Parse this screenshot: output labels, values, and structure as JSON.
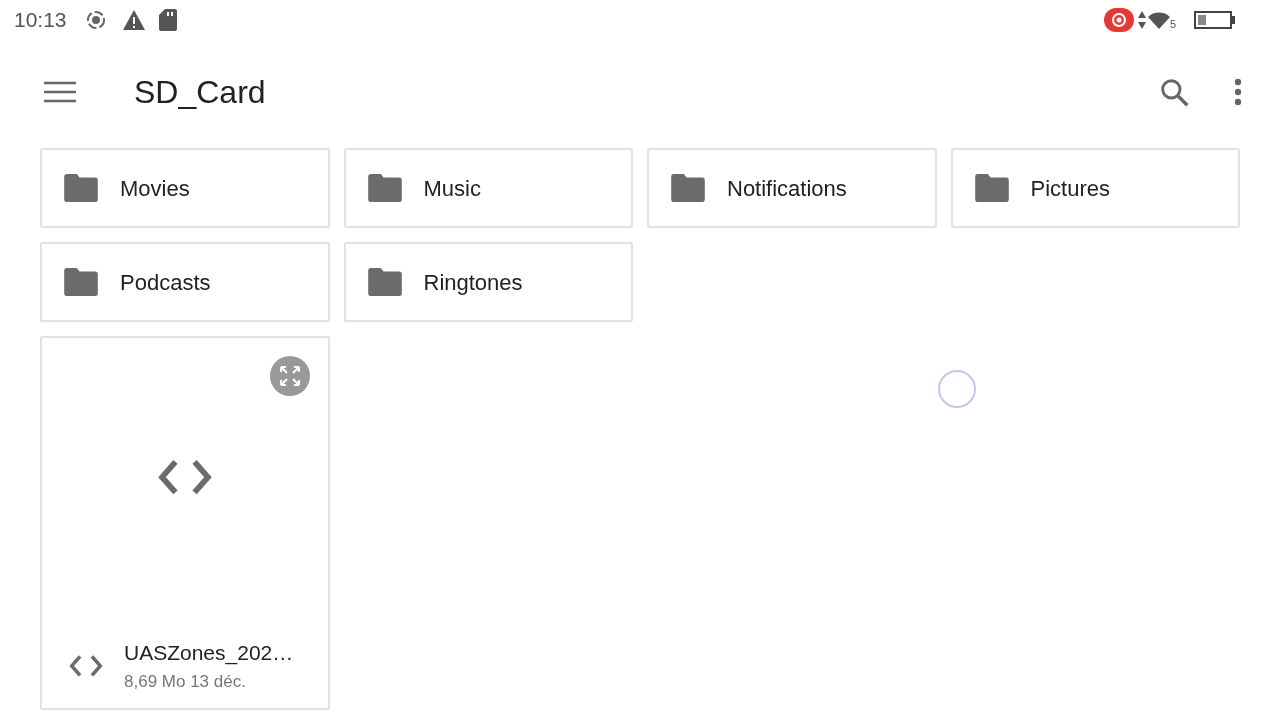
{
  "status_bar": {
    "time": "10:13",
    "network_label": "5"
  },
  "toolbar": {
    "title": "SD_Card"
  },
  "folders": [
    {
      "name": "Movies"
    },
    {
      "name": "Music"
    },
    {
      "name": "Notifications"
    },
    {
      "name": "Pictures"
    },
    {
      "name": "Podcasts"
    },
    {
      "name": "Ringtones"
    }
  ],
  "files": [
    {
      "name": "UASZones_202…",
      "details": "8,69 Mo 13 déc."
    }
  ]
}
